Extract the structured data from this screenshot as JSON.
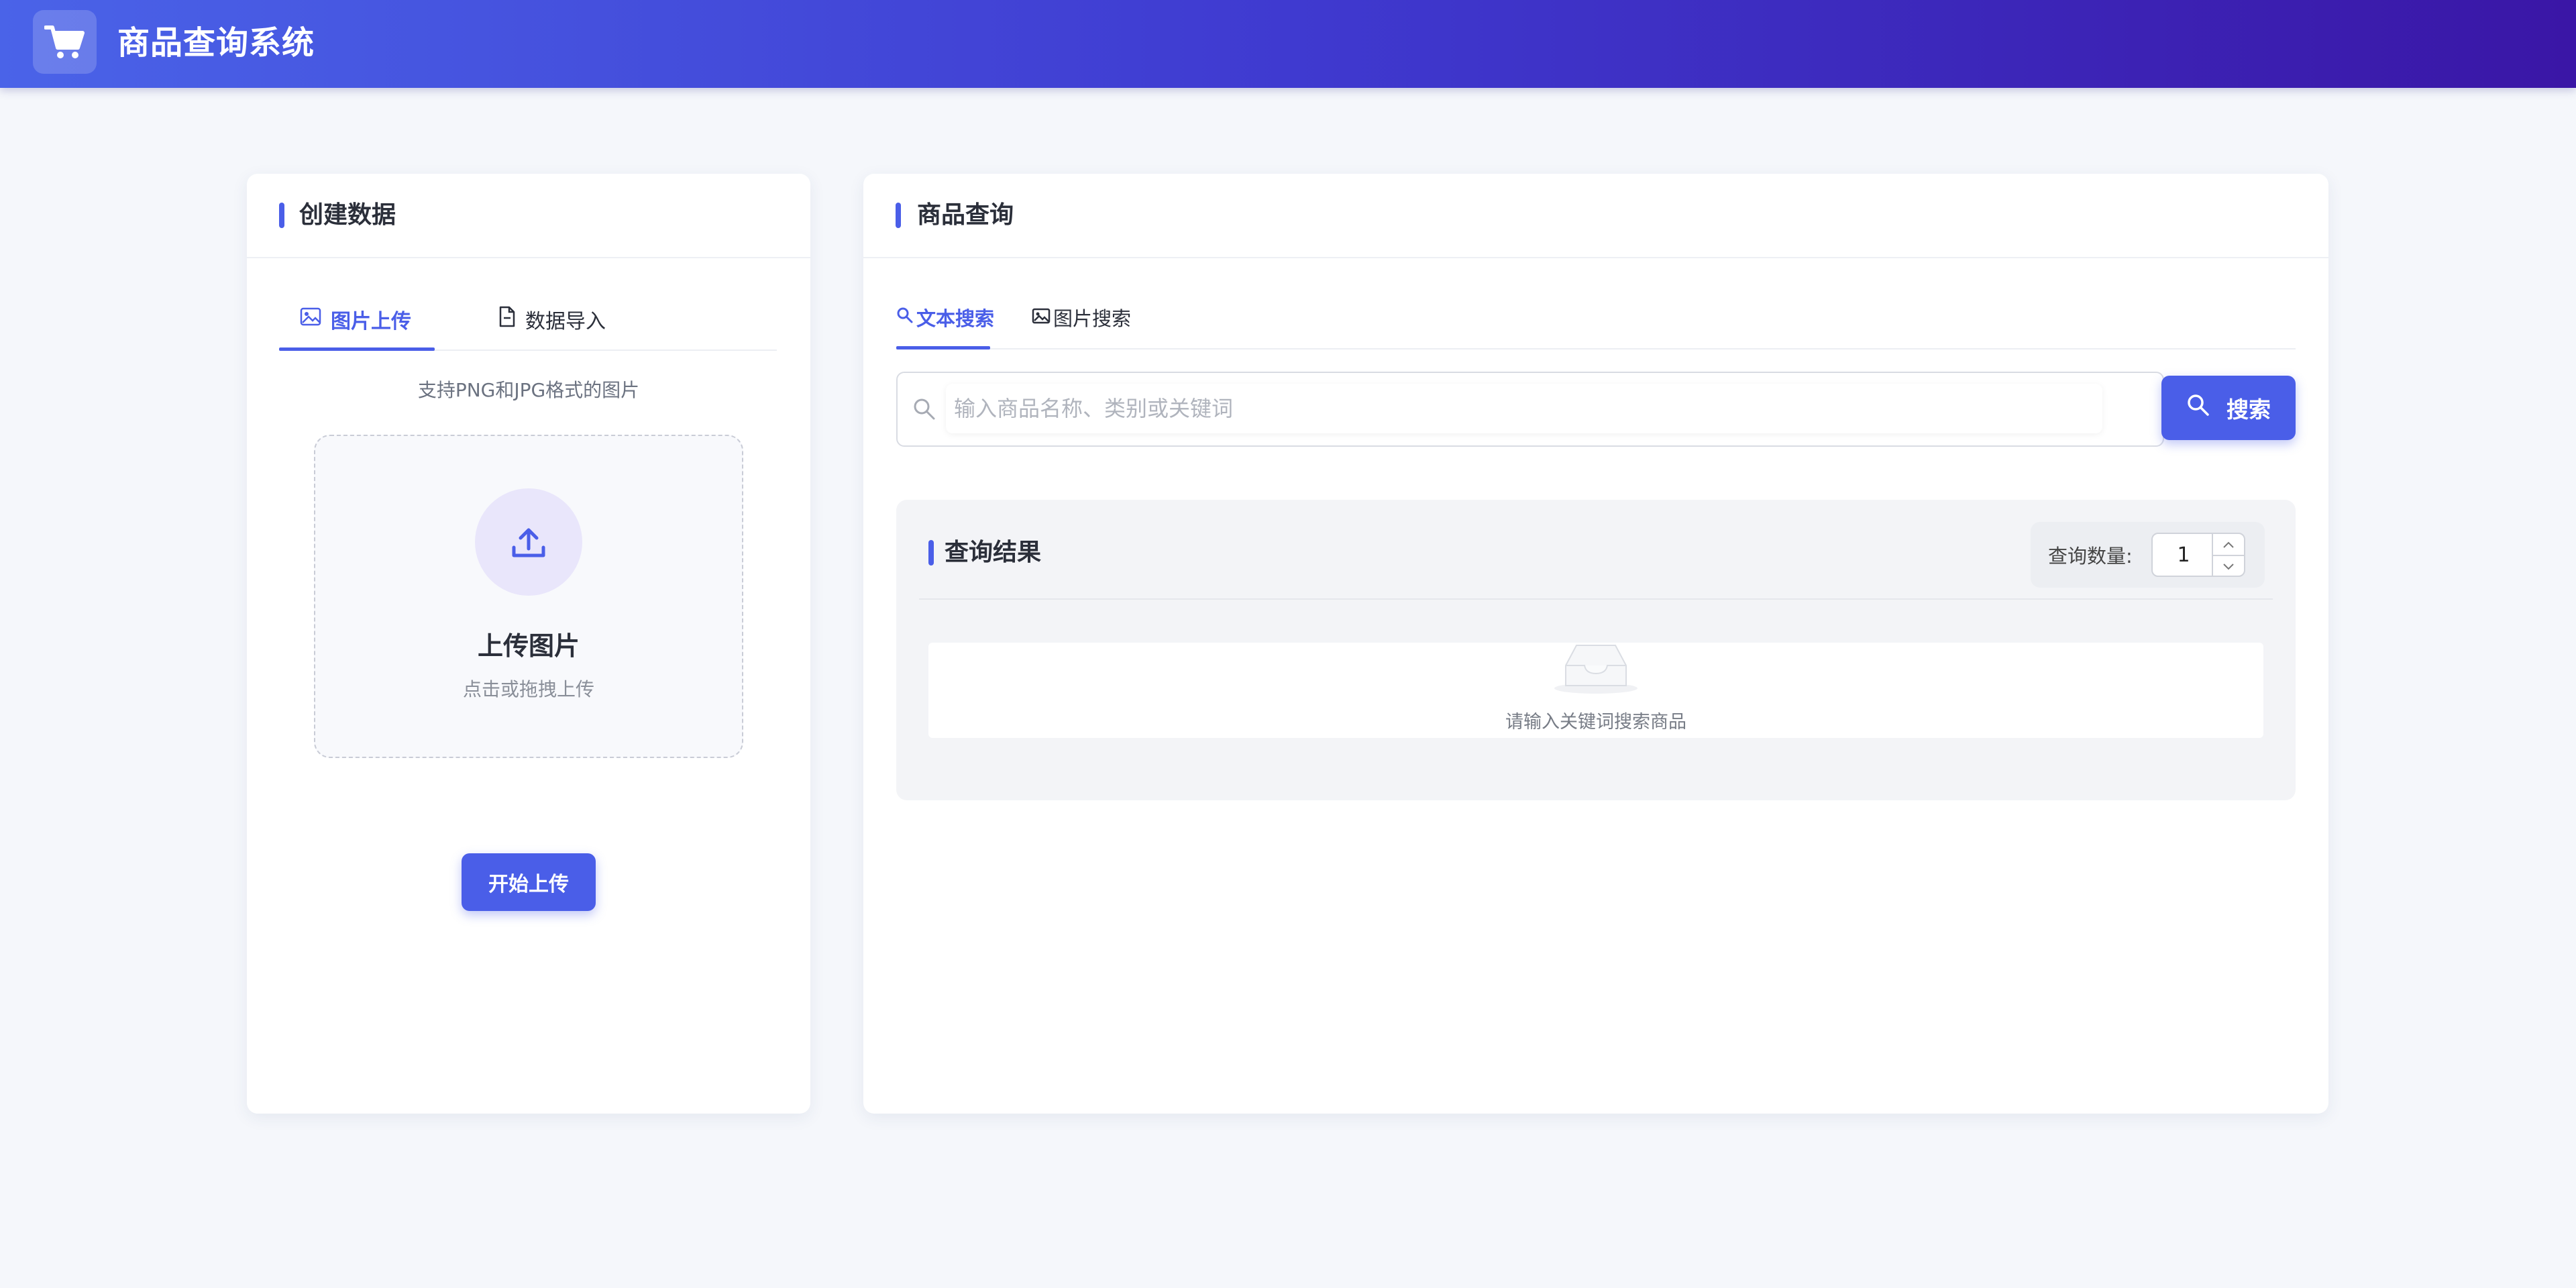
{
  "header": {
    "app_title": "商品查询系统",
    "logo_icon": "shopping-cart-icon",
    "gradient_colors": [
      "#4a63e8",
      "#3a16a6"
    ]
  },
  "create_card": {
    "title": "创建数据",
    "tabs": [
      {
        "label": "图片上传",
        "icon": "image-icon",
        "active": true
      },
      {
        "label": "数据导入",
        "icon": "file-icon",
        "active": false
      }
    ],
    "format_hint": "支持PNG和JPG格式的图片",
    "dropzone": {
      "icon": "upload-icon",
      "title": "上传图片",
      "subtitle": "点击或拖拽上传"
    },
    "start_button": "开始上传"
  },
  "query_card": {
    "title": "商品查询",
    "tabs": [
      {
        "label": "文本搜索",
        "icon": "search-icon",
        "active": true
      },
      {
        "label": "图片搜索",
        "icon": "image-icon",
        "active": false
      }
    ],
    "search": {
      "placeholder": "输入商品名称、类别或关键词",
      "value": "",
      "button_label": "搜索"
    },
    "results": {
      "title": "查询结果",
      "quantity_label": "查询数量:",
      "quantity_value": "1",
      "empty_icon": "inbox-icon",
      "empty_text": "请输入关键词搜索商品"
    }
  },
  "colors": {
    "accent": "#4a5ee8",
    "page_bg": "#f5f7fb"
  }
}
